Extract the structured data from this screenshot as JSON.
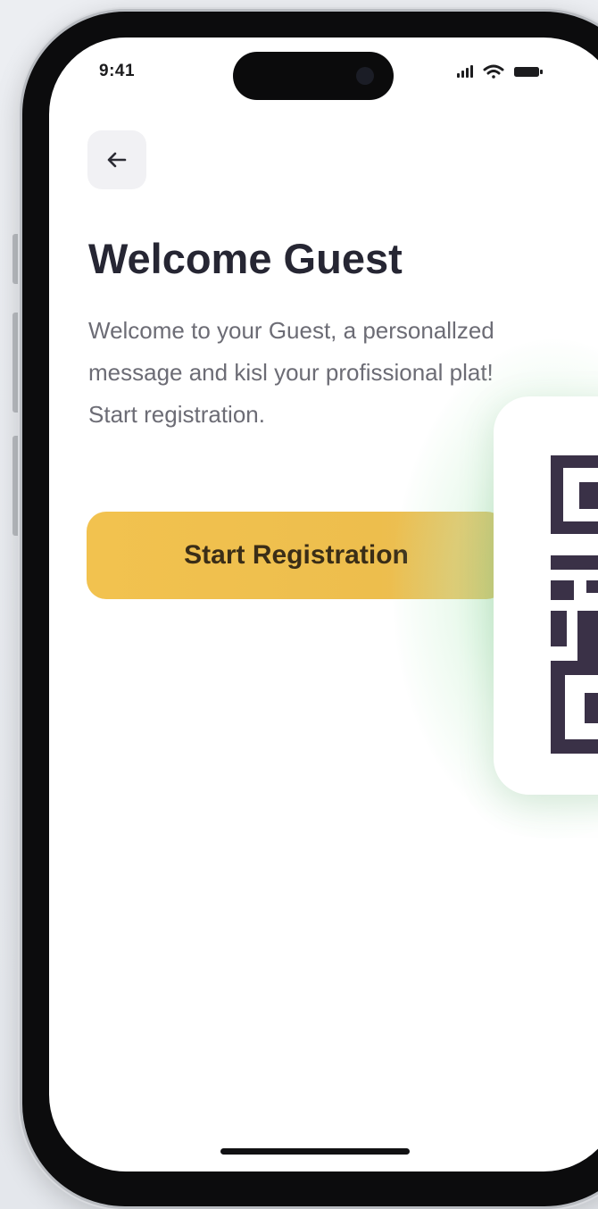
{
  "status_bar": {
    "time": "9:41",
    "icons": [
      "signal-icon",
      "wifi-icon",
      "battery-icon"
    ]
  },
  "nav": {
    "back_icon": "arrow-left-icon"
  },
  "welcome": {
    "title": "Welcome Guest",
    "description": "Welcome to your Guest, a personallzed message and kisl your profissional plat! Start registration.",
    "cta_label": "Start Registration"
  },
  "qr_card": {
    "icon": "qr-code-icon"
  },
  "colors": {
    "accent": "#F0C14F",
    "title": "#262633",
    "body_text": "#6C6C75",
    "qr_dark": "#3A3147",
    "glow": "#87DC96"
  }
}
